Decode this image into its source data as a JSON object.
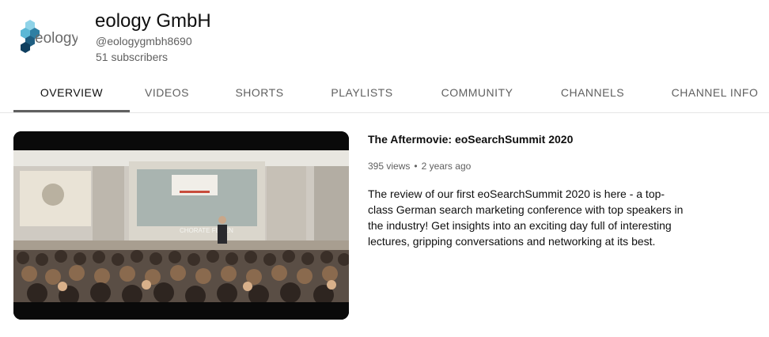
{
  "channel": {
    "name": "eology GmbH",
    "handle": "@eologygmbh8690",
    "subscribers": "51 subscribers",
    "logo_text": "eology",
    "logo_colors": [
      "#8fd3e8",
      "#5cb8d6",
      "#2f7fa3",
      "#1f5f82",
      "#6a6a6a"
    ]
  },
  "tabs": [
    {
      "label": "OVERVIEW",
      "active": true
    },
    {
      "label": "VIDEOS",
      "active": false
    },
    {
      "label": "SHORTS",
      "active": false
    },
    {
      "label": "PLAYLISTS",
      "active": false
    },
    {
      "label": "COMMUNITY",
      "active": false
    },
    {
      "label": "CHANNELS",
      "active": false
    },
    {
      "label": "CHANNEL INFO",
      "active": false
    }
  ],
  "featured_video": {
    "title": "The Aftermovie: eoSearchSummit 2020",
    "views": "395 views",
    "separator": "•",
    "age": "2 years ago",
    "description": "The review of our first eoSearchSummit 2020 is here - a top-class German search marketing conference with top speakers in the industry! Get insights into an exciting day full of interesting lectures, gripping conversations and networking at its best.",
    "thumbnail_screen_text": "CHORATE  FEREN"
  }
}
